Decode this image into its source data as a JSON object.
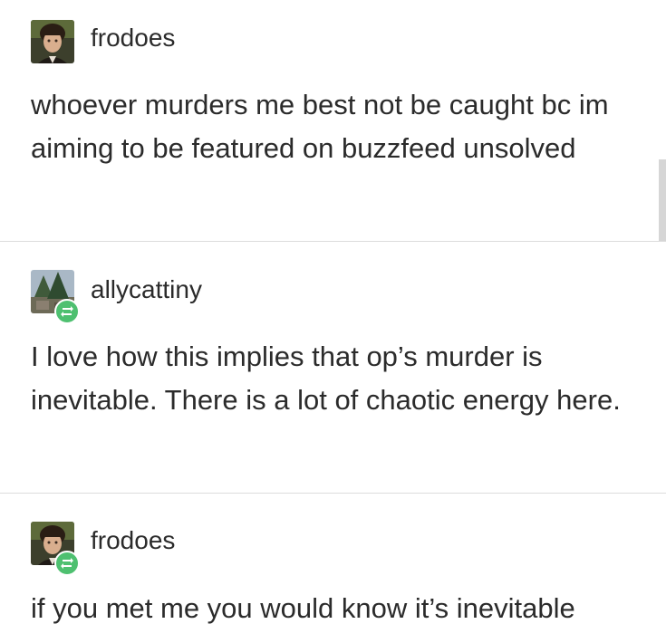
{
  "posts": [
    {
      "username": "frodoes",
      "avatar_icon": "user-avatar-portrait",
      "reblog": false,
      "text": "whoever murders me best not be caught bc im aiming to be featured on buzzfeed unsolved"
    },
    {
      "username": "allycattiny",
      "avatar_icon": "user-avatar-landscape",
      "reblog": true,
      "text": "I love how this implies that op’s murder is inevitable. There is a lot of chaotic energy here."
    },
    {
      "username": "frodoes",
      "avatar_icon": "user-avatar-portrait",
      "reblog": true,
      "text": "if you met me you would know it’s inevitable"
    }
  ],
  "colors": {
    "text": "#2b2b2b",
    "divider": "#dcdcdc",
    "reblog_badge": "#4ec070",
    "background": "#ffffff"
  }
}
